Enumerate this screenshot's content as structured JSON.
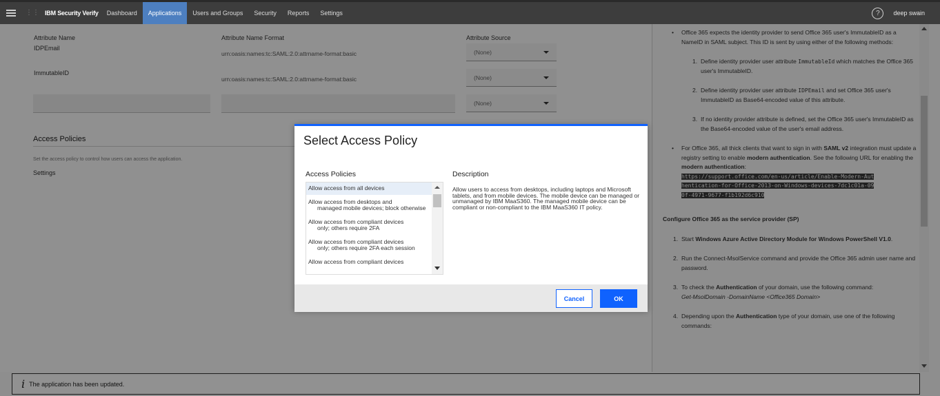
{
  "nav": {
    "brand": "IBM Security Verify",
    "items": [
      {
        "label": "Dashboard",
        "active": false
      },
      {
        "label": "Applications",
        "active": true
      },
      {
        "label": "Users and Groups",
        "active": false
      },
      {
        "label": "Security",
        "active": false
      },
      {
        "label": "Reports",
        "active": false
      },
      {
        "label": "Settings",
        "active": false
      }
    ],
    "help_icon": "?",
    "user": "deep swain"
  },
  "form": {
    "col_headers": {
      "name": "Attribute Name",
      "format": "Attribute Name Format",
      "source": "Attribute Source"
    },
    "rows": [
      {
        "name": "IDPEmail",
        "format": "urn:oasis:names:tc:SAML:2.0:attrname-format:basic",
        "source": "(None)"
      },
      {
        "name": "ImmutableID",
        "format": "urn:oasis:names:tc:SAML:2.0:attrname-format:basic",
        "source": "(None)"
      },
      {
        "name": "",
        "format": "",
        "source": "(None)"
      }
    ],
    "access_policies_title": "Access Policies",
    "access_policies_note": "Set the access policy to control how users can access the application.",
    "settings_label": "Settings"
  },
  "help": {
    "bullet1": "Office 365 expects the identity provider to send Office 365 user's ImmutableID as a NameID in SAML subject. This ID is sent by using either of the following methods:",
    "methods": [
      {
        "n": "1.",
        "pre": "Define identity provider user attribute ",
        "code": "ImmutableId",
        "post": " which matches the Office 365 user's ImmutableID."
      },
      {
        "n": "2.",
        "pre": "Define identity provider user attribute ",
        "code": "IDPEmail",
        "post": " and set Office 365 user's ImmutableID as Base64-encoded value of this attribute."
      },
      {
        "n": "3.",
        "pre": "If no identity provider attribute is defined, set the Office 365 user's ImmutableID as the Base64-encoded value of the user's email address.",
        "code": "",
        "post": ""
      }
    ],
    "bullet2_pre": "For Office 365, all thick clients that want to sign in with ",
    "bullet2_bold1": "SAML v2",
    "bullet2_mid": " integration must update a registry setting to enable ",
    "bullet2_bold2": "modern authentication",
    "bullet2_mid2": ". See the following URL for enabling the ",
    "bullet2_bold3": "modern authentication",
    "bullet2_end": ":",
    "url_lines": [
      "https://support.office.com/en-us/article/Enable-Modern-Aut",
      "hentication-for-Office-2013-on-Windows-devices-7dc1c01a-09",
      "0f-4971-9677-f1b192d6c910"
    ],
    "sp_heading": "Configure Office 365 as the service provider (SP)",
    "steps": [
      {
        "n": "1.",
        "pre": "Start ",
        "bold": "Windows Azure Active Directory Module for Windows PowerShell V1.0",
        "post": "."
      },
      {
        "n": "2.",
        "pre": "Run the Connect-MsolService command and provide the Office 365 admin user name and password.",
        "bold": "",
        "post": ""
      },
      {
        "n": "3.",
        "pre": "To check the ",
        "bold": "Authentication",
        "post": " of your domain, use the following command:",
        "italic": "Get-MsolDomain -DomainName <Office365 Domain>"
      },
      {
        "n": "4.",
        "pre": "Depending upon the ",
        "bold": "Authentication",
        "post": " type of your domain, use one of the following commands:"
      }
    ]
  },
  "status": {
    "icon": "i",
    "message": "The application has been updated."
  },
  "modal": {
    "title": "Select Access Policy",
    "list_header": "Access Policies",
    "desc_header": "Description",
    "policies": [
      {
        "first": "Allow access from all devices",
        "rest": ""
      },
      {
        "first": "Allow access from desktops and",
        "rest": "managed mobile devices; block otherwise"
      },
      {
        "first": "Allow access from compliant devices",
        "rest": "only; others require 2FA"
      },
      {
        "first": "Allow access from compliant devices",
        "rest": "only; others require 2FA each session"
      },
      {
        "first": "Allow access from compliant devices",
        "rest": ""
      }
    ],
    "description": "Allow users to access from desktops, including laptops and Microsoft tablets, and from mobile devices. The mobile device can be managed or unmanaged by IBM MaaS360. The managed mobile device can be compliant or non-compliant to the IBM MaaS360 IT policy.",
    "cancel_label": "Cancel",
    "ok_label": "OK"
  }
}
